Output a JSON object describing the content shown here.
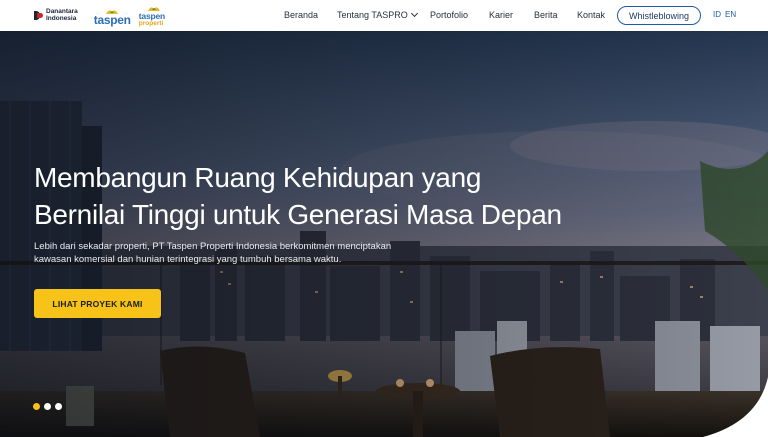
{
  "header": {
    "logos": {
      "danantara_line1": "Danantara",
      "danantara_line2": "Indonesia",
      "taspen": "taspen",
      "taspen_properti_line1": "taspen",
      "taspen_properti_line2": "properti"
    },
    "nav": [
      {
        "label": "Beranda"
      },
      {
        "label": "Tentang TASPRO",
        "has_dropdown": true
      },
      {
        "label": "Portofolio"
      },
      {
        "label": "Karier"
      },
      {
        "label": "Berita"
      },
      {
        "label": "Kontak"
      }
    ],
    "whistleblowing_label": "Whistleblowing",
    "languages": [
      "ID",
      "EN"
    ]
  },
  "hero": {
    "title_line1": "Membangun Ruang Kehidupan yang",
    "title_line2": "Bernilai Tinggi untuk Generasi Masa Depan",
    "desc_line1": "Lebih dari sekadar properti, PT Taspen Properti Indonesia berkomitmen menciptakan",
    "desc_line2": "kawasan komersial dan hunian terintegrasi yang tumbuh bersama waktu.",
    "cta_label": "LIHAT PROYEK KAMI",
    "slides": [
      {
        "active": true
      },
      {
        "active": false
      },
      {
        "active": false
      }
    ]
  },
  "colors": {
    "accent": "#f7c318",
    "brand_blue": "#2d6db5",
    "brand_gold": "#e9a71f",
    "nav_text": "#2a2f3a"
  }
}
